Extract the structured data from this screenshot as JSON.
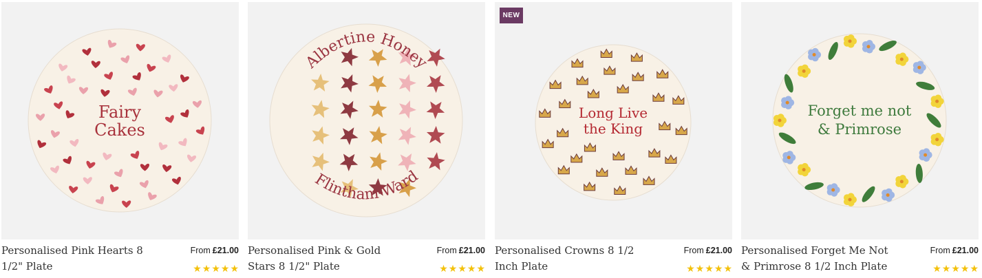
{
  "products": [
    {
      "title": "Personalised Pink Hearts 8 1/2\" Plate",
      "price_prefix": "From",
      "price": "£21.00",
      "rating_stars": 5,
      "badge": "",
      "plate_text_line1": "Fairy",
      "plate_text_line2": "Cakes",
      "plate_text_color": "#a8323c",
      "pattern": "hearts"
    },
    {
      "title": "Personalised Pink & Gold Stars 8 1/2\" Plate",
      "price_prefix": "From",
      "price": "£21.00",
      "rating_stars": 5,
      "badge": "",
      "plate_text_top": "Albertine Honey",
      "plate_text_bottom": "Flintham-Ward",
      "plate_text_color": "#9a3541",
      "pattern": "stars"
    },
    {
      "title": "Personalised Crowns 8 1/2 Inch Plate",
      "price_prefix": "From",
      "price": "£21.00",
      "rating_stars": 5,
      "badge": "NEW",
      "plate_text_line1": "Long Live",
      "plate_text_line2": "the King",
      "plate_text_color": "#b42831",
      "pattern": "crowns"
    },
    {
      "title": "Personalised Forget Me Not & Primrose 8 1/2 Inch Plate",
      "price_prefix": "From",
      "price": "£21.00",
      "rating_stars": 5,
      "badge": "",
      "plate_text_line1": "Forget me not",
      "plate_text_line2": "& Primrose",
      "plate_text_color": "#3e7a3d",
      "pattern": "flowers"
    }
  ],
  "colors": {
    "badge_bg": "#6b3a63",
    "star": "#f3c10c",
    "image_bg": "#f2f2f2",
    "plate": "#f8f1e6"
  }
}
